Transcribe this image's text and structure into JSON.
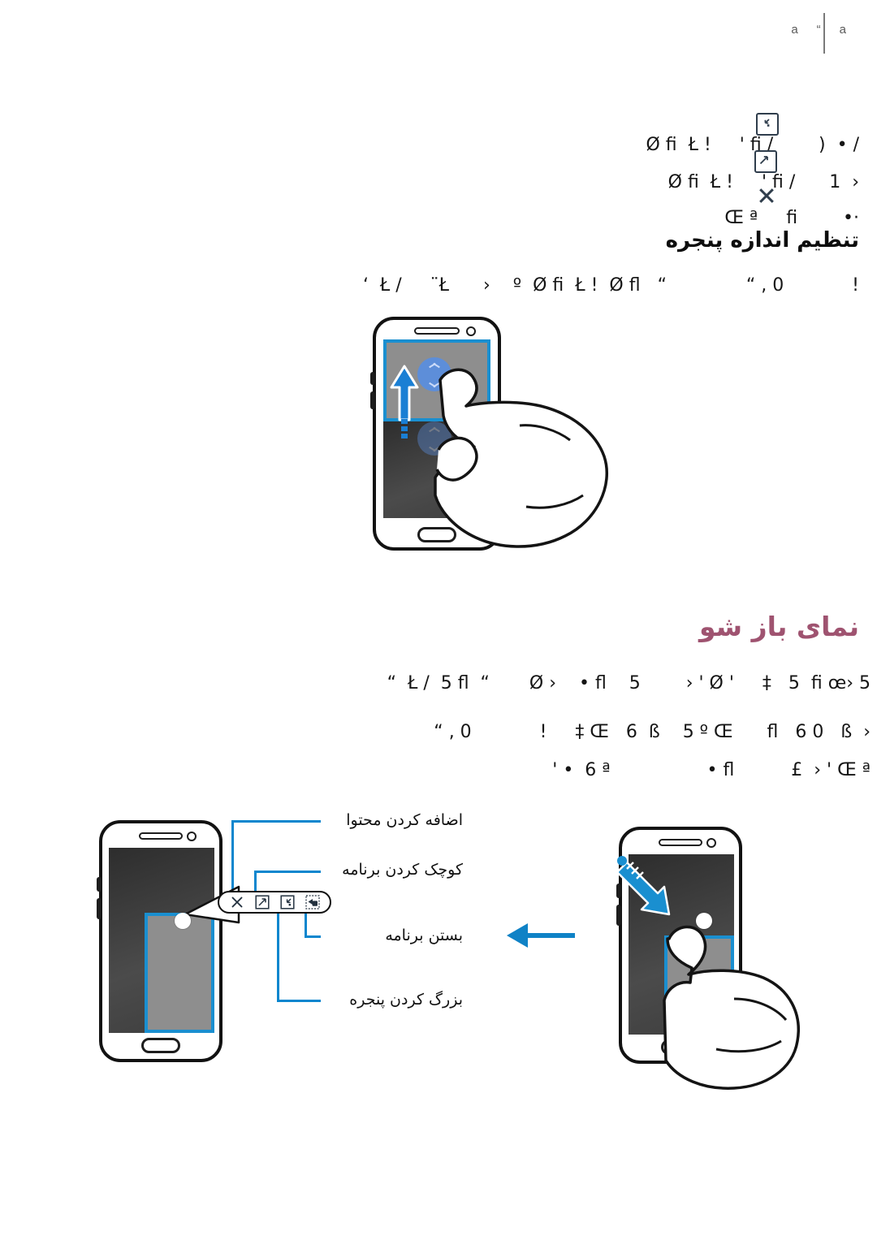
{
  "page": {
    "header": {
      "left_text": "a",
      "mid_text": "“",
      "right_text": "a"
    },
    "sections": [
      {
        "id": "resize-window",
        "heading": "تنظیم اندازه پنجره",
        "heading_color": "#0d0d0d",
        "body_lines": [
          "Ø fi  Ł !     ' fi /        )  • /",
          "Ø fi  Ł !     ' fi /      1  ›",
          "Œ ª     fi        •·",
          "‘  Ł /     ¨Ł      ›    º  Ø fi  Ł !  Ø fl   “              “ , 0            !"
        ]
      },
      {
        "id": "pop-up-view",
        "heading": "نمای باز شو",
        "heading_color": "#9f5370",
        "body_lines": [
          "“  Ł /  5 fl  “       Ø ›    • fl    5        › ' Ø '     ‡   5  fi œ› 5",
          "“ , 0            !     ‡ Œ   6  ß    5 º Œ      fl   6 0   ß  ›",
          "' •  6 ª                 • fl          £  › ' Œ ª"
        ]
      }
    ],
    "annotations": [
      {
        "id": "add-content",
        "label": "اضافه کردن محتوا"
      },
      {
        "id": "minimize-app",
        "label": "کوچک کردن برنامه"
      },
      {
        "id": "close-app",
        "label": "بستن برنامه"
      },
      {
        "id": "maximize-window",
        "label": "بزرگ کردن پنجره"
      }
    ],
    "toolbar_icons": [
      {
        "id": "close-icon",
        "name": "close-icon"
      },
      {
        "id": "maximize-icon",
        "name": "maximize-icon"
      },
      {
        "id": "minimize-icon",
        "name": "minimize-icon"
      },
      {
        "id": "add-content-icon",
        "name": "add-content-icon"
      }
    ],
    "colors": {
      "accent_blue": "#0a86ce",
      "screen_blue": "#1a8fd0",
      "heading_rose": "#9f5370",
      "icon_slate": "#2f3d4c",
      "drag_blue": "#5b8ede"
    },
    "illustrations": [
      {
        "id": "split-resize-phone",
        "gesture": "drag-divider-up"
      },
      {
        "id": "popup-toolbar-phone",
        "gesture": "tap-handle"
      },
      {
        "id": "popup-drag-phone",
        "gesture": "drag-corner-down"
      }
    ]
  }
}
